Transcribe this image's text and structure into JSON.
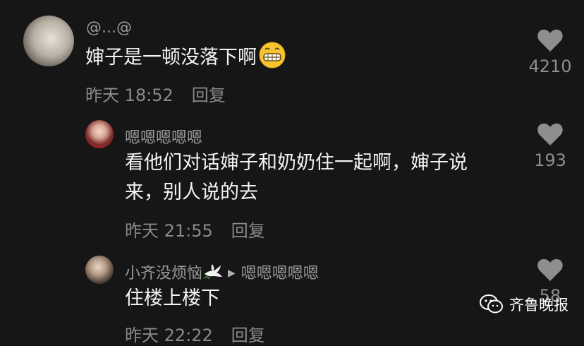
{
  "comments": [
    {
      "username": "@...@",
      "text": "婶子是一顿没落下啊",
      "emoji": "grinning-face-emoji",
      "time": "昨天 18:52",
      "reply_label": "回复",
      "likes": "4210"
    },
    {
      "username": "嗯嗯嗯嗯嗯",
      "text_line1": "看他们对话婶子和奶奶住一起啊，婶子说",
      "text_line2": "来，别人说的去",
      "time": "昨天 21:55",
      "reply_label": "回复",
      "likes": "193"
    },
    {
      "username": "小齐没烦恼",
      "icon": "dove-icon",
      "reply_to": "嗯嗯嗯嗯嗯",
      "text": "住楼上楼下",
      "time": "昨天 22:22",
      "reply_label": "回复",
      "likes": "58"
    }
  ],
  "watermark": {
    "label": "齐鲁晚报",
    "icon": "wechat-icon"
  },
  "colors": {
    "background": "#161616",
    "text": "#f4f4f4",
    "muted": "#8a8a8a",
    "heart": "#8e8e8e"
  }
}
